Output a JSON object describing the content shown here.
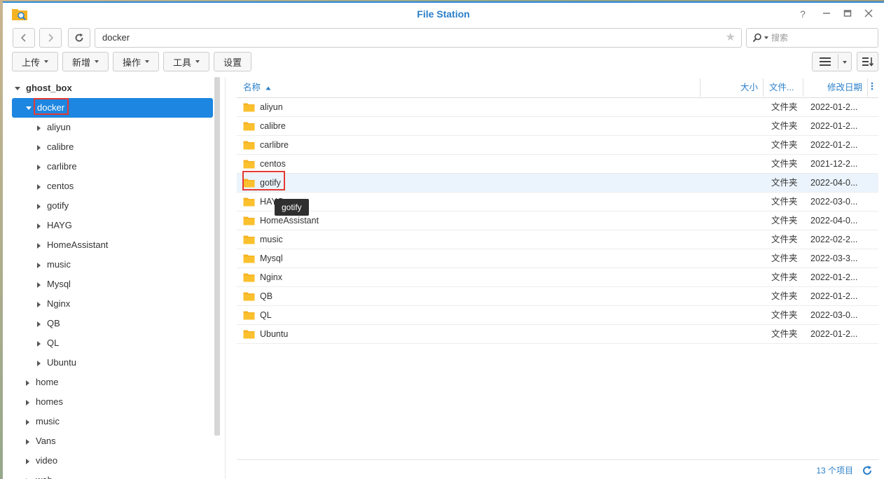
{
  "window": {
    "title": "File Station"
  },
  "nav": {
    "path": "docker",
    "search_placeholder": "搜索"
  },
  "toolbar": {
    "upload": "上传",
    "create": "新增",
    "action": "操作",
    "tools": "工具",
    "settings": "设置"
  },
  "tree": {
    "root": "ghost_box",
    "selected": "docker",
    "children": [
      "aliyun",
      "calibre",
      "carlibre",
      "centos",
      "gotify",
      "HAYG",
      "HomeAssistant",
      "music",
      "Mysql",
      "Nginx",
      "QB",
      "QL",
      "Ubuntu"
    ],
    "siblings": [
      "home",
      "homes",
      "music",
      "Vans",
      "video",
      "web"
    ]
  },
  "grid": {
    "headers": {
      "name": "名称",
      "size": "大小",
      "type": "文件...",
      "modified": "修改日期"
    },
    "rows": [
      {
        "name": "aliyun",
        "type": "文件夹",
        "modified": "2022-01-2..."
      },
      {
        "name": "calibre",
        "type": "文件夹",
        "modified": "2022-01-2..."
      },
      {
        "name": "carlibre",
        "type": "文件夹",
        "modified": "2022-01-2..."
      },
      {
        "name": "centos",
        "type": "文件夹",
        "modified": "2021-12-2..."
      },
      {
        "name": "gotify",
        "type": "文件夹",
        "modified": "2022-04-0..."
      },
      {
        "name": "HAYG",
        "type": "文件夹",
        "modified": "2022-03-0..."
      },
      {
        "name": "HomeAssistant",
        "type": "文件夹",
        "modified": "2022-04-0..."
      },
      {
        "name": "music",
        "type": "文件夹",
        "modified": "2022-02-2..."
      },
      {
        "name": "Mysql",
        "type": "文件夹",
        "modified": "2022-03-3..."
      },
      {
        "name": "Nginx",
        "type": "文件夹",
        "modified": "2022-01-2..."
      },
      {
        "name": "QB",
        "type": "文件夹",
        "modified": "2022-01-2..."
      },
      {
        "name": "QL",
        "type": "文件夹",
        "modified": "2022-03-0..."
      },
      {
        "name": "Ubuntu",
        "type": "文件夹",
        "modified": "2022-01-2..."
      }
    ]
  },
  "tooltip": "gotify",
  "footer": {
    "count": "13 个项目"
  },
  "colors": {
    "accent": "#2a7fc9",
    "selected": "#1d86e0",
    "folder": "#f5b324",
    "highlight": "#e53935"
  }
}
